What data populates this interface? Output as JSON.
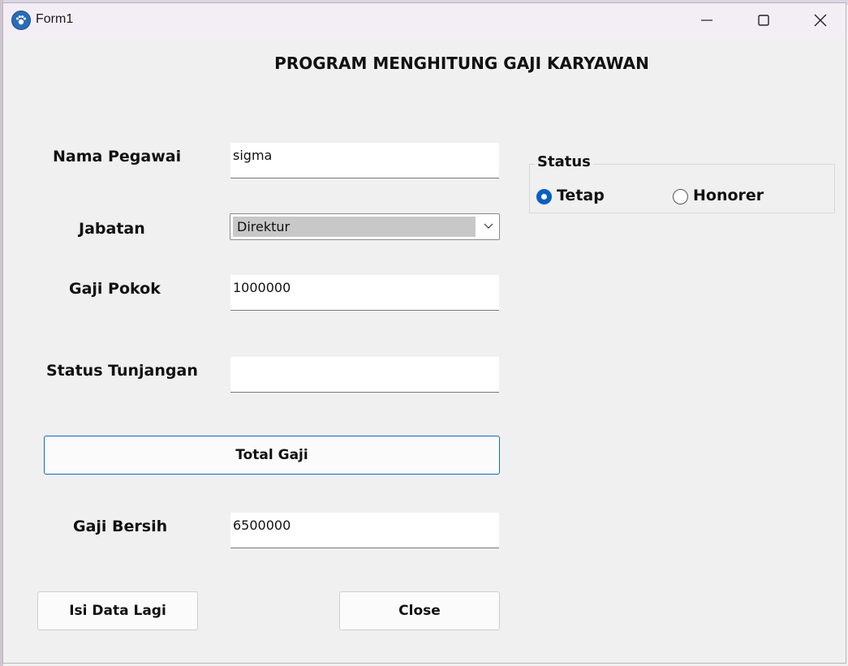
{
  "window": {
    "title": "Form1",
    "minimize_icon": "minimize-icon",
    "maximize_icon": "maximize-icon",
    "close_icon": "close-icon"
  },
  "form": {
    "heading": "PROGRAM MENGHITUNG GAJI KARYAWAN",
    "nama_pegawai": {
      "label": "Nama Pegawai",
      "value": "sigma"
    },
    "jabatan": {
      "label": "Jabatan",
      "selected": "Direktur"
    },
    "gaji_pokok": {
      "label": "Gaji Pokok",
      "value": "1000000"
    },
    "status_tunjangan": {
      "label": "Status Tunjangan",
      "value": ""
    },
    "total_button": "Total Gaji",
    "gaji_bersih": {
      "label": "Gaji Bersih",
      "value": "6500000"
    },
    "isi_button": "Isi Data Lagi",
    "close_button": "Close"
  },
  "status_group": {
    "title": "Status",
    "options": [
      {
        "label": "Tetap",
        "checked": true
      },
      {
        "label": "Honorer",
        "checked": false
      }
    ]
  },
  "colors": {
    "accent": "#0a5fc0",
    "form_background": "#f0f0f0"
  }
}
